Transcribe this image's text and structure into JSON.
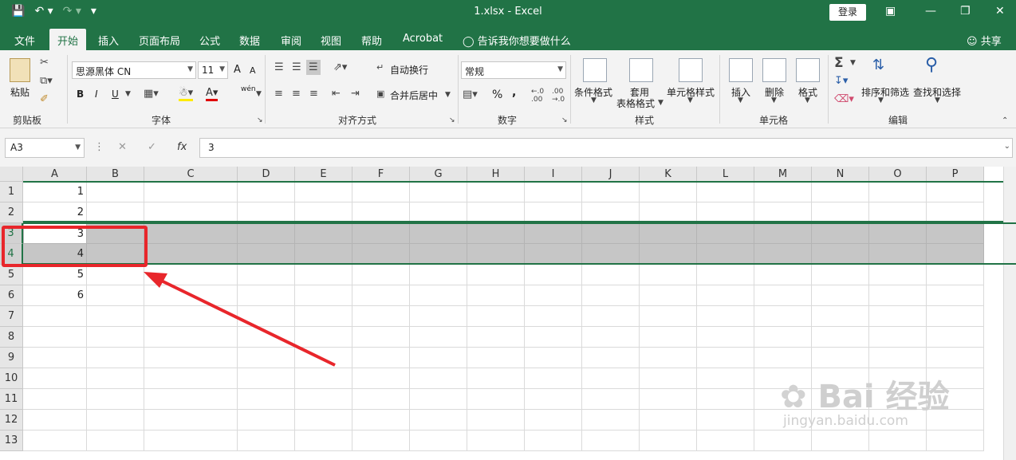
{
  "titlebar": {
    "title": "1.xlsx  -  Excel",
    "login": "登录",
    "qat": {
      "save_icon": "save-icon",
      "undo_icon": "undo-icon",
      "redo_icon": "redo-icon"
    }
  },
  "tabs": [
    "文件",
    "开始",
    "插入",
    "页面布局",
    "公式",
    "数据",
    "审阅",
    "视图",
    "帮助",
    "Acrobat"
  ],
  "active_tab": "开始",
  "tellme": "告诉我你想要做什么",
  "share": "共享",
  "ribbon": {
    "clipboard": {
      "paste": "粘贴",
      "label": "剪贴板"
    },
    "font": {
      "name": "思源黑体 CN",
      "size": "11",
      "bold": "B",
      "italic": "I",
      "underline": "U",
      "inc": "A",
      "dec": "A",
      "label": "字体",
      "wen": "wén"
    },
    "align": {
      "wrap": "自动换行",
      "merge": "合并后居中",
      "label": "对齐方式"
    },
    "number": {
      "format": "常规",
      "percent": "%",
      "comma": ",",
      "label": "数字"
    },
    "styles": {
      "cond": "条件格式",
      "table1": "套用",
      "table2": "表格格式",
      "cell": "单元格样式",
      "label": "样式"
    },
    "cells": {
      "insert": "插入",
      "delete": "删除",
      "format": "格式",
      "label": "单元格"
    },
    "edit": {
      "sort": "排序和筛选",
      "find": "查找和选择",
      "label": "编辑"
    }
  },
  "formula_bar": {
    "name_box": "A3",
    "fx": "fx",
    "value": "3"
  },
  "columns": [
    "A",
    "B",
    "C",
    "D",
    "E",
    "F",
    "G",
    "H",
    "I",
    "J",
    "K",
    "L",
    "M",
    "N",
    "O",
    "P"
  ],
  "rows": [
    "1",
    "2",
    "3",
    "4",
    "5",
    "6",
    "7",
    "8",
    "9",
    "10",
    "11",
    "12",
    "13"
  ],
  "colA": [
    "1",
    "2",
    "3",
    "4",
    "5",
    "6",
    "",
    "",
    "",
    "",
    "",
    "",
    ""
  ],
  "watermark": {
    "main": "Bai 经验",
    "sub": "jingyan.baidu.com"
  },
  "colors": {
    "excel_green": "#217346",
    "annotation_red": "#e8262b",
    "selection_gray": "#c6c6c6"
  }
}
